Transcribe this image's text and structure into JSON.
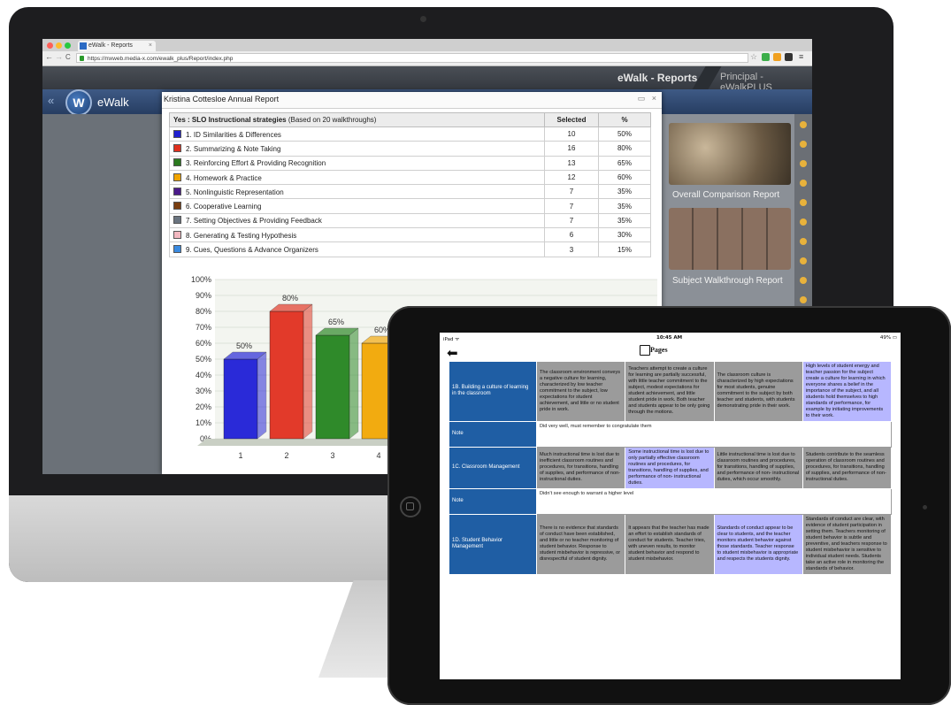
{
  "browser": {
    "tab_title": "eWalk - Reports",
    "url": "https://mxweb.media-x.com/ewalk_plus/Report/index.php",
    "back_glyph": "←",
    "forward_glyph": "→",
    "reload_glyph": "C",
    "tab_close": "×"
  },
  "app": {
    "brand": "eWalk",
    "section_title": "eWalk - Reports",
    "role_title": "Principal - eWalkPLUS",
    "back_glyph": "«",
    "logo_letter": "W"
  },
  "side_panel": {
    "items": [
      {
        "label": "Overall Comparison Report"
      },
      {
        "label": "Subject Walkthrough Report"
      }
    ]
  },
  "modal": {
    "title": "Kristina Cottesloe Annual Report",
    "restore_glyph": "▭",
    "close_glyph": "×",
    "table": {
      "header": {
        "prefix": "Yes : ",
        "bold": "SLO Instructional strategies",
        "suffix": " (Based on 20 walkthroughs)",
        "selected": "Selected",
        "pct": "%"
      },
      "rows": [
        {
          "color": "#2020d0",
          "label": "1. ID Similarities & Differences",
          "selected": "10",
          "pct": "50%"
        },
        {
          "color": "#e0301e",
          "label": "2. Summarizing & Note Taking",
          "selected": "16",
          "pct": "80%"
        },
        {
          "color": "#2b7a1f",
          "label": "3. Reinforcing Effort & Providing Recognition",
          "selected": "13",
          "pct": "65%"
        },
        {
          "color": "#f0a400",
          "label": "4. Homework & Practice",
          "selected": "12",
          "pct": "60%"
        },
        {
          "color": "#4b1a8a",
          "label": "5. Nonlinguistic Representation",
          "selected": "7",
          "pct": "35%"
        },
        {
          "color": "#7a3e10",
          "label": "6. Cooperative Learning",
          "selected": "7",
          "pct": "35%"
        },
        {
          "color": "#6a7480",
          "label": "7. Setting Objectives & Providing Feedback",
          "selected": "7",
          "pct": "35%"
        },
        {
          "color": "#f2b8c0",
          "label": "8. Generating & Testing Hypothesis",
          "selected": "6",
          "pct": "30%"
        },
        {
          "color": "#3a8ae0",
          "label": "9. Cues, Questions & Advance Organizers",
          "selected": "3",
          "pct": "15%"
        }
      ]
    }
  },
  "chart_data": {
    "type": "bar",
    "categories": [
      "1",
      "2",
      "3",
      "4"
    ],
    "values": [
      50,
      80,
      65,
      60
    ],
    "data_labels": [
      "50%",
      "80%",
      "65%",
      "60%"
    ],
    "colors": [
      "#2a2ad8",
      "#e23a2a",
      "#2f8a2a",
      "#f2ab10"
    ],
    "ylim": [
      0,
      100
    ],
    "yticks": [
      "0%",
      "10%",
      "20%",
      "30%",
      "40%",
      "50%",
      "60%",
      "70%",
      "80%",
      "90%",
      "100%"
    ],
    "grid": true,
    "style": "3d"
  },
  "ipad": {
    "status_left": "iPad ᯤ",
    "status_time": "10:45 AM",
    "status_right": "49% ▭",
    "back_glyph": "⬅",
    "pages_label": "Pages",
    "rubric": [
      {
        "type": "criteria",
        "label": "1B. Building a culture of learning in the classroom",
        "cells": [
          {
            "text": "The classroom environment conveys a negative culture for learning, characterized by low teacher commitment to the subject, low expectations for student achievement, and little or no student pride in work.",
            "selected": false
          },
          {
            "text": "Teachers attempt to create a culture for learning are partially successful, with little teacher commitment to the subject, modest expectations for student achievement, and little student pride in work. Both teacher and students appear to be only going through the motions.",
            "selected": false
          },
          {
            "text": "The classroom culture is characterized by high expectations for most students, genuine commitment to the subject by both teacher and students, with students demonstrating pride in their work.",
            "selected": false
          },
          {
            "text": "High levels of student energy and teacher passion for the subject create a culture for learning in which everyone shares a belief in the importance of the subject, and all students hold themselves to high standards of performance, for example by initiating improvements to their work.",
            "selected": true
          }
        ]
      },
      {
        "type": "note",
        "label": "Note",
        "text": "Did very well, must remember to congratulate them"
      },
      {
        "type": "criteria",
        "label": "1C. Classroom Management",
        "cells": [
          {
            "text": "Much instructional time is lost due to inefficient classroom routines and procedures, for transitions, handling of supplies, and performance of non-instructional duties.",
            "selected": false
          },
          {
            "text": "Some instructional time is lost due to only partially effective classroom routines and procedures, for transitions, handling of supplies, and performance of non- instructional duties.",
            "selected": true
          },
          {
            "text": "Little instructional time is lost due to classroom routines and procedures, for transitions, handling of supplies, and performance of non- instructional duties, which occur smoothly.",
            "selected": false
          },
          {
            "text": "Students contribute to the seamless operation of classroom routines and procedures, for transitions, handling of supplies, and performance of non-instructional duties.",
            "selected": false
          }
        ]
      },
      {
        "type": "note",
        "label": "Note",
        "text": "Didn't see enough to warrant a higher level"
      },
      {
        "type": "criteria",
        "label": "1D. Student Behavior Management",
        "cells": [
          {
            "text": "There is no evidence that standards of conduct have been established, and little or no teacher monitoring of student behavior. Response to student misbehavior is repressive, or disrespectful of student dignity.",
            "selected": false
          },
          {
            "text": "It appears that the teacher has made an effort to establish standards of conduct for students. Teacher tries, with uneven results, to monitor student behavior and respond to student misbehavior.",
            "selected": false
          },
          {
            "text": "Standards of conduct appear to be clear to students, and the teacher monitors student behavior against those standards. Teacher response to student misbehavior is appropriate and respects the students dignity.",
            "selected": true
          },
          {
            "text": "Standards of conduct are clear, with evidence of student participation in setting them. Teachers monitoring of student behavior is subtle and preventive, and teachers response to student misbehavior is sensitive to individual student needs. Students take an active role in monitoring the standards of behavior.",
            "selected": false
          }
        ]
      }
    ]
  }
}
